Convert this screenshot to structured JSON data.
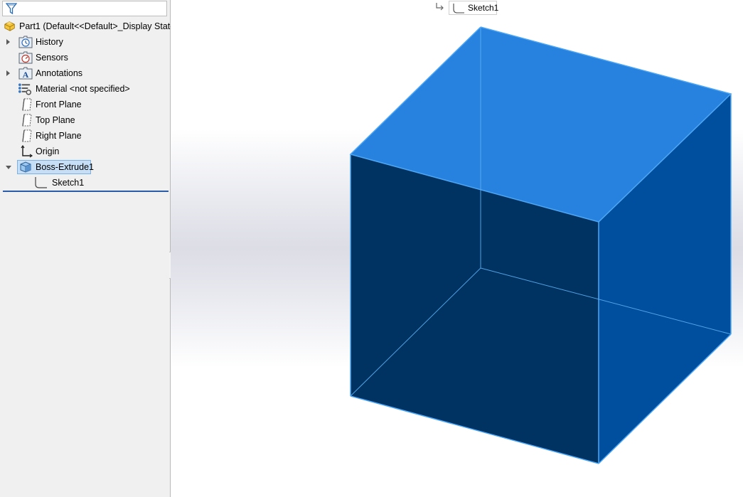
{
  "tree": {
    "root_label": "Part1  (Default<<Default>_Display State",
    "items": [
      {
        "label": "History",
        "icon": "history-icon",
        "expandable": true
      },
      {
        "label": "Sensors",
        "icon": "sensors-icon",
        "expandable": false
      },
      {
        "label": "Annotations",
        "icon": "annotations-icon",
        "expandable": true
      },
      {
        "label": "Material <not specified>",
        "icon": "material-icon",
        "expandable": false
      },
      {
        "label": "Front Plane",
        "icon": "plane-icon",
        "expandable": false
      },
      {
        "label": "Top Plane",
        "icon": "plane-icon",
        "expandable": false
      },
      {
        "label": "Right Plane",
        "icon": "plane-icon",
        "expandable": false
      },
      {
        "label": "Origin",
        "icon": "origin-icon",
        "expandable": false
      },
      {
        "label": "Boss-Extrude1",
        "icon": "extrude-icon",
        "expandable": true,
        "expanded": true,
        "selected": true
      },
      {
        "label": "Sketch1",
        "icon": "sketch-icon",
        "expandable": false,
        "child": true
      }
    ]
  },
  "breadcrumb": {
    "label": "Sketch1"
  },
  "colors": {
    "cube_top": "#2781df",
    "cube_front": "#003262",
    "cube_right": "#004e9e",
    "cube_edge": "#4da7f4",
    "selection_bg": "#c6dff6",
    "selection_border": "#7ab2e6"
  }
}
